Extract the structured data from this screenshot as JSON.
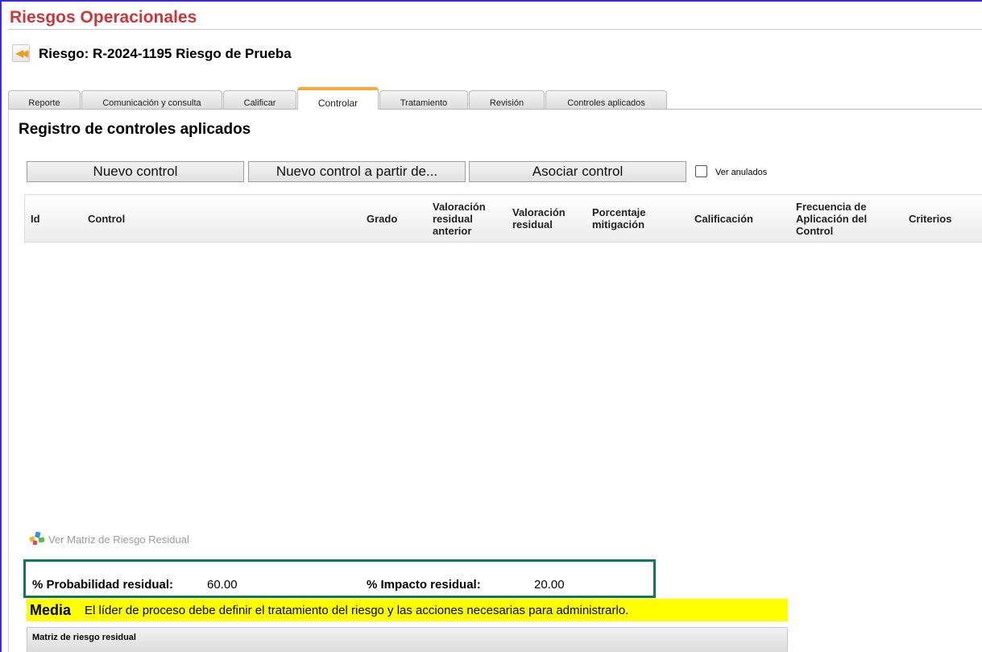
{
  "app": {
    "title": "Riesgos Operacionales"
  },
  "risk": {
    "title": "Riesgo: R-2024-1195 Riesgo de Prueba",
    "back_icon": "double-chevron-left-icon"
  },
  "tabs": [
    {
      "label": "Reporte",
      "active": false
    },
    {
      "label": "Comunicación y consulta",
      "active": false
    },
    {
      "label": "Calificar",
      "active": false
    },
    {
      "label": "Controlar",
      "active": true
    },
    {
      "label": "Tratamiento",
      "active": false
    },
    {
      "label": "Revisión",
      "active": false
    },
    {
      "label": "Controles aplicados",
      "active": false
    }
  ],
  "section": {
    "title": "Registro de controles aplicados"
  },
  "toolbar": {
    "new_control": "Nuevo control",
    "new_from": "Nuevo control a partir de...",
    "associate": "Asociar control",
    "show_voided": {
      "label": "Ver anulados",
      "checked": false
    }
  },
  "grid": {
    "columns": [
      {
        "lines": [
          "Id"
        ]
      },
      {
        "lines": [
          "Control"
        ]
      },
      {
        "lines": [
          "Grado"
        ]
      },
      {
        "lines": [
          "Valoración",
          "residual",
          "anterior"
        ]
      },
      {
        "lines": [
          "Valoración",
          "residual"
        ]
      },
      {
        "lines": [
          "Porcentaje",
          "mitigación"
        ]
      },
      {
        "lines": [
          "Calificación"
        ]
      },
      {
        "lines": [
          "Frecuencia de",
          "Aplicación del",
          "Control"
        ]
      },
      {
        "lines": [
          "Criterios"
        ]
      }
    ],
    "rows": []
  },
  "matrix_link": {
    "label": "Ver Matriz de Riesgo Residual",
    "icon": "matrix-chart-icon"
  },
  "residual": {
    "probability_label": "% Probabilidad residual:",
    "probability_value": "60.00",
    "impact_label": "% Impacto residual:",
    "impact_value": "20.00"
  },
  "level": {
    "name": "Media",
    "message": "El líder de proceso debe definir el tratamiento del riesgo y las acciones necesarias para administrarlo.",
    "color": "#ffff00"
  },
  "matrix_panel": {
    "title": "Matriz de riesgo residual"
  },
  "colors": {
    "title": "#c8373a",
    "active_tab": "#f4a93a",
    "residual_border": "#0e7a53",
    "frame": "#3a2be0"
  }
}
